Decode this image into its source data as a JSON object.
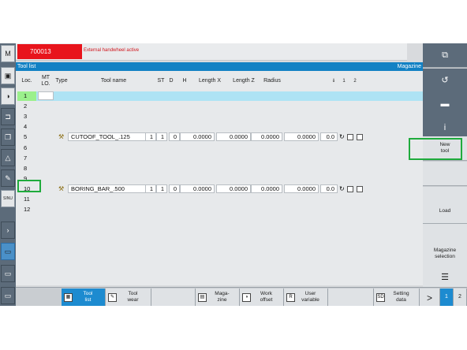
{
  "header": {
    "logo": "M",
    "alarm_code": "700013",
    "alarm_message": "External handwheel active"
  },
  "titlebar": {
    "title": "Tool list",
    "right": "Magazine"
  },
  "columns": [
    "Loc.",
    "MT LO.",
    "Type",
    "Tool name",
    "ST",
    "D",
    "H",
    "Length X",
    "Length Z",
    "Radius"
  ],
  "rows": [
    {
      "loc": "1",
      "selected": true
    },
    {
      "loc": "2"
    },
    {
      "loc": "3"
    },
    {
      "loc": "4"
    },
    {
      "loc": "5",
      "tool": {
        "name": "CUTOOF_TOOL_.125",
        "st": "1",
        "d": "1",
        "h": "0",
        "lx": "0.0000",
        "lz": "0.0000",
        "r": "0.0000",
        "v1": "0.0000",
        "v2": "0.0"
      }
    },
    {
      "loc": "6"
    },
    {
      "loc": "7"
    },
    {
      "loc": "8"
    },
    {
      "loc": "9"
    },
    {
      "loc": "10",
      "tool": {
        "name": "BORING_BAR_.500",
        "st": "1",
        "d": "1",
        "h": "0",
        "lx": "0.0000",
        "lz": "0.0000",
        "r": "0.0000",
        "v1": "0.0000",
        "v2": "0.0"
      }
    },
    {
      "loc": "11"
    },
    {
      "loc": "12"
    }
  ],
  "right_softkeys": {
    "new_tool": "New\ntool",
    "load": "Load",
    "magazine_selection": "Magazine\nselection"
  },
  "bottom_softkeys": {
    "tool_list": "Tool\nlist",
    "tool_wear": "Tool\nwear",
    "magazine": "Maga-\nzine",
    "work_offset": "Work\noffset",
    "user_variable": "User\nvariable",
    "setting_data": "Setting\ndata",
    "next": ">",
    "page1": "1",
    "page2": "2",
    "icon_r": "R",
    "icon_sd": "SD"
  },
  "colors": {
    "accent": "#1281c4",
    "alarm": "#e8141c",
    "highlight": "#1fab3c"
  }
}
